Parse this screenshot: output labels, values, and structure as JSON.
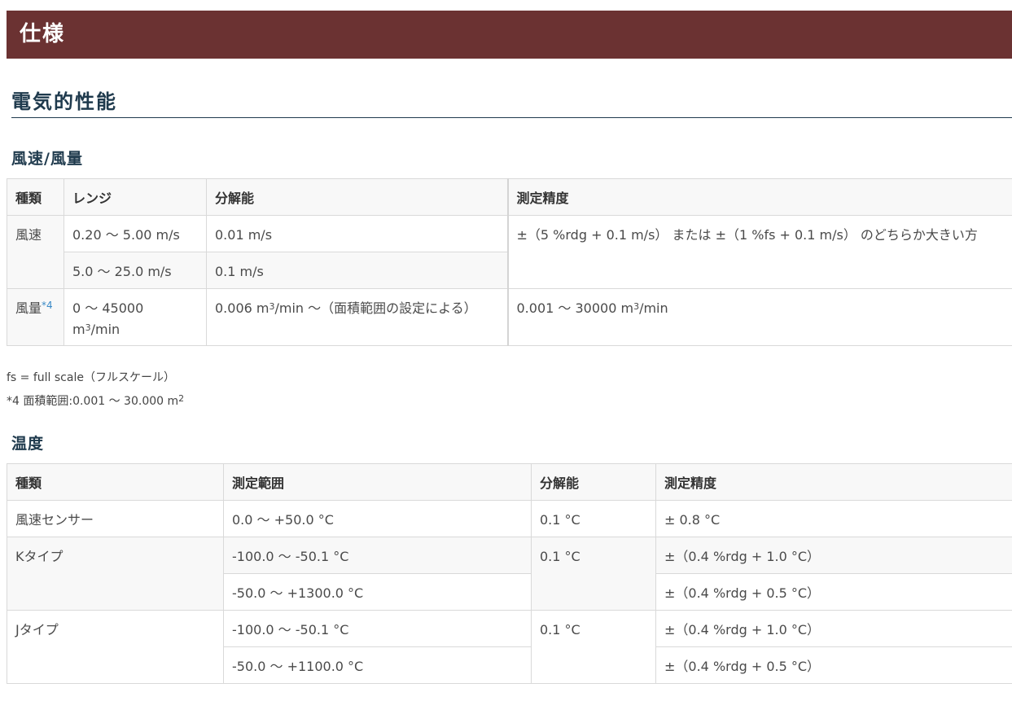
{
  "banner": {
    "title": "仕様"
  },
  "section": {
    "title": "電気的性能"
  },
  "wind": {
    "heading": "風速/風量",
    "headers": [
      "種類",
      "レンジ",
      "分解能",
      "測定精度"
    ],
    "rows": {
      "speed_type": "風速",
      "speed_range1": "0.20 〜 5.00 m/s",
      "speed_res1": "0.01 m/s",
      "speed_acc": "±（5 %rdg + 0.1 m/s） または ±（1 %fs + 0.1 m/s） のどちらか大きい方",
      "speed_range2": "5.0 〜 25.0 m/s",
      "speed_res2": "0.1 m/s",
      "vol_type": "風量",
      "vol_note_mark": "*4",
      "vol_range_a": "0 〜 45000",
      "vol_range_unit_a": "m",
      "vol_range_exp": "3",
      "vol_range_unit_b": "/min",
      "vol_res_a": "0.006 m",
      "vol_res_exp": "3",
      "vol_res_b": "/min 〜（面積範囲の設定による）",
      "vol_acc_a": "0.001 〜 30000 m",
      "vol_acc_exp": "3",
      "vol_acc_b": "/min"
    }
  },
  "notes": {
    "fs": "fs = full scale（フルスケール）",
    "area_a": "*4 面積範囲:0.001 〜 30.000 m",
    "area_exp": "2"
  },
  "temp": {
    "heading": "温度",
    "headers": [
      "種類",
      "測定範囲",
      "分解能",
      "測定精度"
    ],
    "rows": {
      "sensor_type": "風速センサー",
      "sensor_range": "0.0 〜 +50.0 °C",
      "sensor_res": "0.1 °C",
      "sensor_acc": "± 0.8 °C",
      "k_type": "Kタイプ",
      "k_range1": "-100.0 〜 -50.1 °C",
      "k_res": "0.1 °C",
      "k_acc1": "±（0.4 %rdg + 1.0 °C）",
      "k_range2": "-50.0 〜 +1300.0 °C",
      "k_acc2": "±（0.4 %rdg + 0.5 °C）",
      "j_type": "Jタイプ",
      "j_range1": "-100.0 〜 -50.1 °C",
      "j_res": "0.1 °C",
      "j_acc1": "±（0.4 %rdg + 1.0 °C）",
      "j_range2": "-50.0 〜 +1100.0 °C",
      "j_acc2": "±（0.4 %rdg + 0.5 °C）"
    }
  }
}
